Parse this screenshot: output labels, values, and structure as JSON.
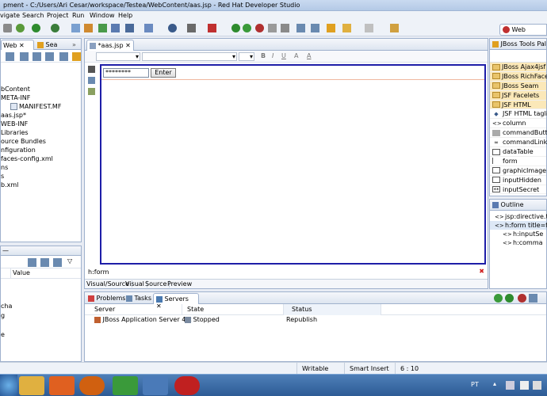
{
  "window": {
    "title": "pment - C:/Users/Ari Cesar/workspace/Testea/WebContent/aas.jsp - Red Hat Developer Studio"
  },
  "menu": [
    "vigate",
    "Search",
    "Project",
    "Run",
    "Window",
    "Help"
  ],
  "explorer": {
    "tabs": [
      "Web",
      "Sea"
    ],
    "tree": [
      "bContent",
      "META-INF",
      "MANIFEST.MF",
      "aas.jsp*",
      "WEB-INF",
      "Libraries",
      "ource Bundles",
      "nfiguration",
      "faces-config.xml",
      "ns",
      "s",
      "b.xml"
    ]
  },
  "properties": {
    "header_value": "Value",
    "rows": [
      "cha",
      "g",
      "e"
    ]
  },
  "editor": {
    "tab": "*aas.jsp",
    "input_value": "********",
    "button_label": "Enter",
    "breadcrumb": "h:form",
    "bottom_tabs": [
      "Visual/Source",
      "Visual",
      "Source",
      "Preview"
    ]
  },
  "palette": {
    "title": "JBoss Tools Palett",
    "perspective": "Web",
    "groups": [
      "JBoss Ajax4jsf",
      "JBoss RichFaces",
      "JBoss Seam",
      "JSF Facelets",
      "JSF HTML"
    ],
    "items": [
      "JSF HTML taglib",
      "column",
      "commandButton",
      "commandLink",
      "dataTable",
      "form",
      "graphicImage",
      "inputHidden",
      "inputSecret"
    ]
  },
  "outline": {
    "title": "Outline",
    "nodes": [
      "jsp:directive.t",
      "h:form title=f",
      "h:inputSe",
      "h:comma"
    ]
  },
  "servers": {
    "tabs": [
      "Problems",
      "Tasks",
      "Servers"
    ],
    "columns": [
      "Server",
      "State",
      "Status"
    ],
    "row": {
      "server": "JBoss Application Server 4.2",
      "state": "Stopped",
      "status": "Republish"
    }
  },
  "statusbar": {
    "mode": "Writable",
    "insert": "Smart Insert",
    "position": "6 : 10"
  },
  "taskbar": {
    "lang": "PT"
  },
  "colors": {
    "editor_border": "#1e1ea8",
    "accent": "#2d5b95"
  }
}
